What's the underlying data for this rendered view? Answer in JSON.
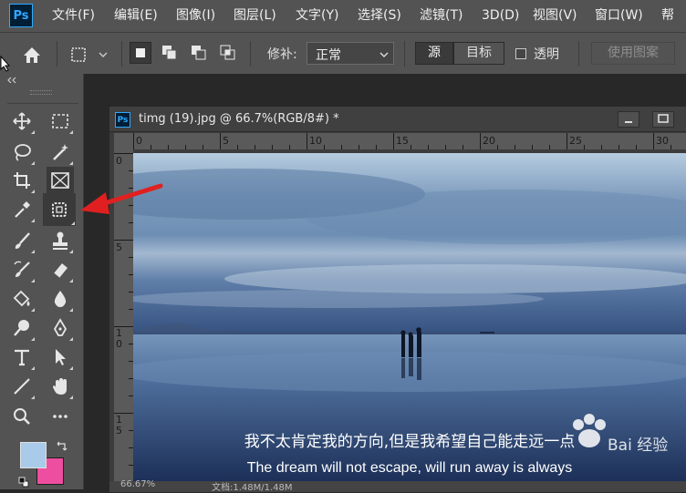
{
  "app": {
    "logo": "Ps"
  },
  "menu": [
    {
      "label": "文件(F)"
    },
    {
      "label": "编辑(E)"
    },
    {
      "label": "图像(I)"
    },
    {
      "label": "图层(L)"
    },
    {
      "label": "文字(Y)"
    },
    {
      "label": "选择(S)"
    },
    {
      "label": "滤镜(T)"
    },
    {
      "label": "3D(D)"
    },
    {
      "label": "视图(V)"
    },
    {
      "label": "窗口(W)"
    },
    {
      "label": "帮"
    }
  ],
  "options": {
    "repair_label": "修补:",
    "repair_mode": "正常",
    "source": "源",
    "target": "目标",
    "transparent": "透明",
    "use_pattern": "使用图案"
  },
  "document": {
    "tab_title": "timg (19).jpg @ 66.7%(RGB/8#) *",
    "zoom": "66.67%",
    "doc_info": "文档:1.48M/1.48M",
    "ruler_h": [
      "0",
      "5",
      "10",
      "15",
      "20",
      "25",
      "30"
    ],
    "ruler_v": [
      "0",
      "5",
      "10",
      "15"
    ]
  },
  "image": {
    "subtitle_cn": "我不太肯定我的方向,但是我希望自己能走远一点",
    "subtitle_en": "The dream will not escape, will run away is always",
    "watermark": "Bai 经验"
  },
  "colors": {
    "foreground": "#a9cbe9",
    "background": "#ee4e9f",
    "accent": "#31a8ff",
    "annotation_arrow": "#e02020"
  }
}
